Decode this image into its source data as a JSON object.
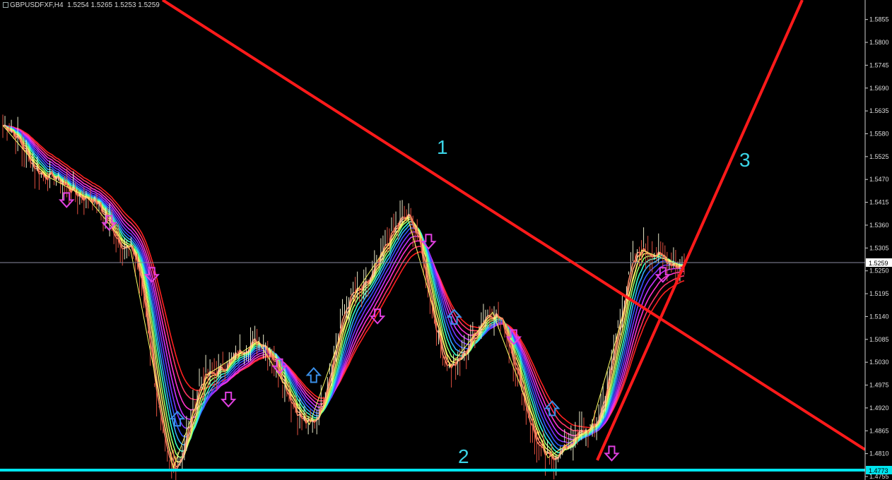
{
  "header": {
    "symbol_tf": "GBPUSDFXF,H4",
    "ohlc": "1.5254 1.5265 1.5253 1.5259"
  },
  "colors": {
    "background": "#000000",
    "trendline": "#ff1a1a",
    "support": "#00e5ee",
    "bid_line": "#8a8aa0",
    "up_arrow": "#3a8fe8",
    "down_arrow": "#e040e0",
    "zigzag": "#ffff66",
    "annotation": "#3ad4e6",
    "ma_ribbon": [
      "#ff2020",
      "#ff3366",
      "#ff33cc",
      "#cc33ff",
      "#7a33ff",
      "#3355ff",
      "#33aaff",
      "#33ffcc",
      "#99ff66",
      "#ffee66",
      "#ffaa77",
      "#ff8866"
    ]
  },
  "chart_data": {
    "type": "line",
    "title": "GBPUSDFXF,H4",
    "xlabel": "",
    "ylabel": "",
    "ylim": [
      1.4755,
      1.5885
    ],
    "y_ticks": [
      "1.5855",
      "1.5800",
      "1.5745",
      "1.5690",
      "1.5635",
      "1.5580",
      "1.5525",
      "1.5470",
      "1.5415",
      "1.5360",
      "1.5305",
      "1.5250",
      "1.5195",
      "1.5140",
      "1.5085",
      "1.5030",
      "1.4975",
      "1.4920",
      "1.4865",
      "1.4810",
      "1.4773",
      "1.4755"
    ],
    "current_price": "1.5259",
    "support_price": "1.4773",
    "annotations": [
      "1",
      "2",
      "3"
    ],
    "series": [
      {
        "x": [
          0,
          10,
          20,
          30,
          40,
          48,
          60,
          72,
          83,
          95,
          105,
          115,
          128,
          138,
          150,
          160
        ],
        "values": [
          1.56,
          1.548,
          1.5425,
          1.53,
          1.4775,
          1.5,
          1.508,
          1.488,
          1.52,
          1.538,
          1.502,
          1.515,
          1.48,
          1.487,
          1.53,
          1.526
        ]
      }
    ]
  }
}
